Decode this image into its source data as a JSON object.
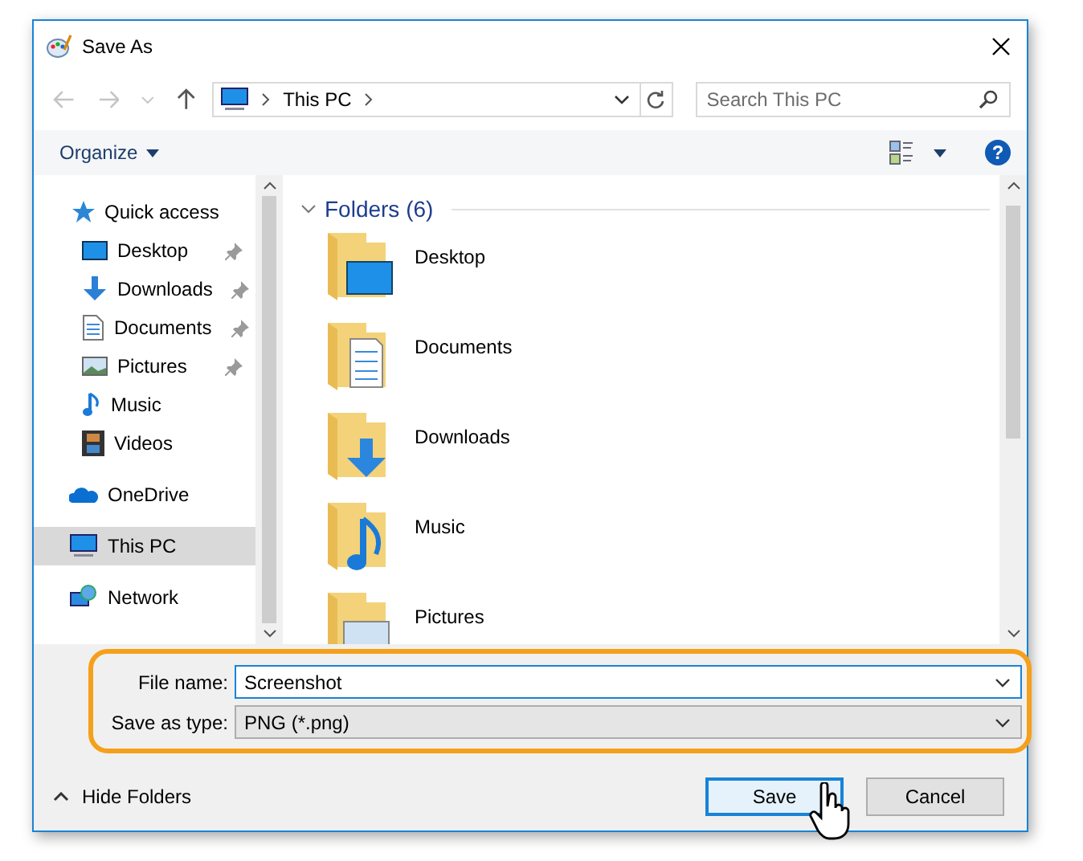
{
  "window": {
    "title": "Save As"
  },
  "address": {
    "segments": [
      "This PC"
    ]
  },
  "search": {
    "placeholder": "Search This PC"
  },
  "toolbar": {
    "organize": "Organize",
    "help": "?"
  },
  "sidebar": {
    "items": [
      {
        "label": "Quick access",
        "kind": "star",
        "selected": false,
        "children": [
          {
            "label": "Desktop",
            "kind": "desktop",
            "pinned": true,
            "selected": false
          },
          {
            "label": "Downloads",
            "kind": "downloads",
            "pinned": true,
            "selected": false
          },
          {
            "label": "Documents",
            "kind": "documents",
            "pinned": true,
            "selected": false
          },
          {
            "label": "Pictures",
            "kind": "pictures",
            "pinned": true,
            "selected": false
          },
          {
            "label": "Music",
            "kind": "music",
            "pinned": false,
            "selected": false
          },
          {
            "label": "Videos",
            "kind": "videos",
            "pinned": false,
            "selected": false
          }
        ]
      },
      {
        "label": "OneDrive",
        "kind": "cloud",
        "selected": false
      },
      {
        "label": "This PC",
        "kind": "pc",
        "selected": true
      },
      {
        "label": "Network",
        "kind": "network",
        "selected": false
      }
    ]
  },
  "content": {
    "group": {
      "title": "Folders (6)",
      "expanded": true
    },
    "folders": [
      {
        "name": "Desktop",
        "kind": "desktop"
      },
      {
        "name": "Documents",
        "kind": "documents"
      },
      {
        "name": "Downloads",
        "kind": "downloads"
      },
      {
        "name": "Music",
        "kind": "music"
      },
      {
        "name": "Pictures",
        "kind": "pictures"
      }
    ]
  },
  "form": {
    "file_name": {
      "label": "File name:",
      "value": "Screenshot"
    },
    "save_type": {
      "label": "Save as type:",
      "value": "PNG (*.png)"
    }
  },
  "footer": {
    "hide_folders": "Hide Folders",
    "buttons": [
      {
        "label": "Save",
        "default": true
      },
      {
        "label": "Cancel",
        "default": false
      }
    ]
  }
}
